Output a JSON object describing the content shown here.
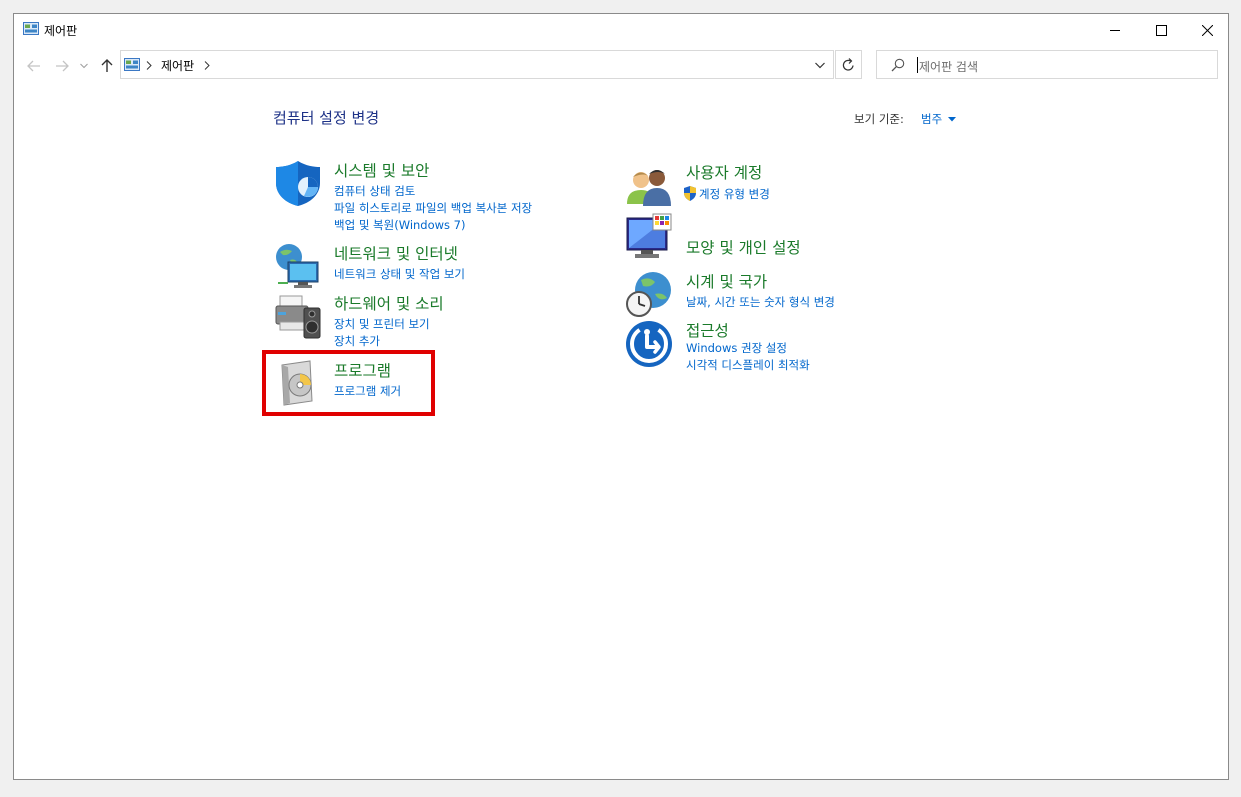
{
  "window": {
    "title": "제어판"
  },
  "address": {
    "crumbs": [
      "제어판"
    ]
  },
  "search": {
    "placeholder": "제어판 검색"
  },
  "header": {
    "title": "컴퓨터 설정 변경",
    "view_by_label": "보기 기준:",
    "view_by_value": "범주"
  },
  "categories_left": [
    {
      "title": "시스템 및 보안",
      "icon": "shield-icon",
      "links": [
        "컴퓨터 상태 검토",
        "파일 히스토리로 파일의 백업 복사본 저장",
        "백업 및 복원(Windows 7)"
      ]
    },
    {
      "title": "네트워크 및 인터넷",
      "icon": "network-icon",
      "links": [
        "네트워크 상태 및 작업 보기"
      ]
    },
    {
      "title": "하드웨어 및 소리",
      "icon": "hardware-sound-icon",
      "links": [
        "장치 및 프린터 보기",
        "장치 추가"
      ]
    },
    {
      "title": "프로그램",
      "icon": "programs-icon",
      "links": [
        "프로그램 제거"
      ]
    }
  ],
  "categories_right": [
    {
      "title": "사용자 계정",
      "icon": "users-icon",
      "links": [
        "계정 유형 변경"
      ]
    },
    {
      "title": "모양 및 개인 설정",
      "icon": "appearance-icon",
      "links": []
    },
    {
      "title": "시계 및 국가",
      "icon": "clock-globe-icon",
      "links": [
        "날짜, 시간 또는 숫자 형식 변경"
      ]
    },
    {
      "title": "접근성",
      "icon": "accessibility-icon",
      "links": [
        "Windows 권장 설정",
        "시각적 디스플레이 최적화"
      ]
    }
  ],
  "colors": {
    "category_title": "#1a7a2a",
    "link": "#0066cc",
    "header": "#1e3287",
    "highlight": "#e00000"
  }
}
